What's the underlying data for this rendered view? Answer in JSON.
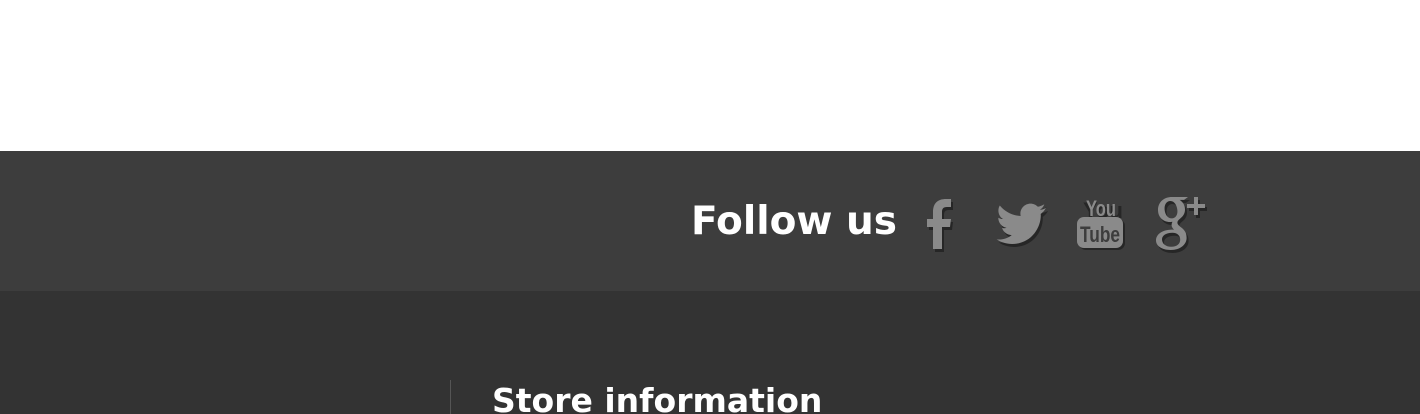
{
  "social": {
    "title": "Follow us",
    "links": [
      {
        "name": "Facebook",
        "icon": "facebook-icon"
      },
      {
        "name": "Twitter",
        "icon": "twitter-icon"
      },
      {
        "name": "YouTube",
        "icon": "youtube-icon",
        "glyph_top": "You",
        "glyph_bottom": "Tube"
      },
      {
        "name": "Google+",
        "icon": "google-plus-icon"
      }
    ],
    "colors": {
      "bar_background": "#3d3d3d",
      "icon_color": "#8a8a8a",
      "icon_shadow": "#262626",
      "title_color": "#ffffff"
    }
  },
  "footer": {
    "store_heading": "Store information",
    "colors": {
      "background": "#333333",
      "divider": "#555555",
      "heading_color": "#ffffff"
    }
  }
}
